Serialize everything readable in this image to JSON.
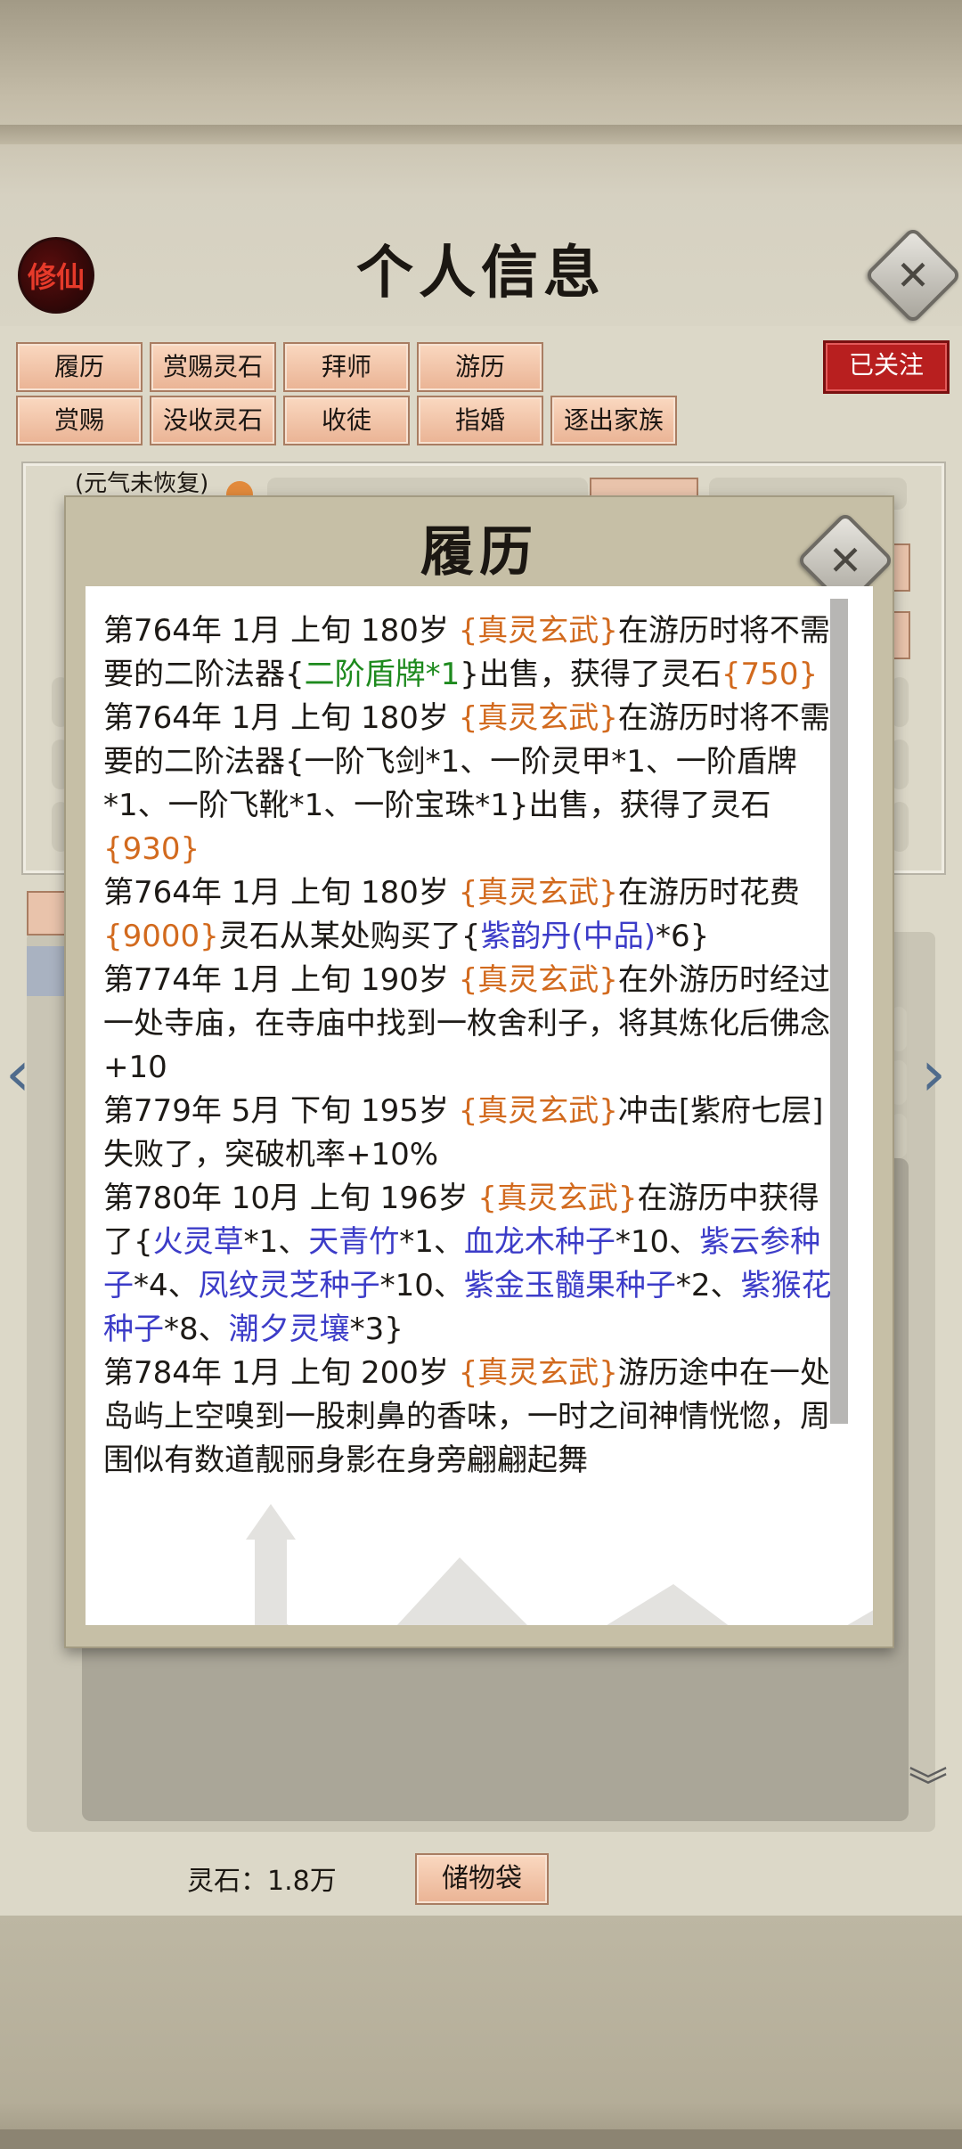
{
  "header": {
    "seal_text": "修仙",
    "title": "个人信息",
    "close_icon": "close-icon"
  },
  "buttons": {
    "row1": [
      "履历",
      "赏赐灵石",
      "拜师",
      "游历"
    ],
    "row2": [
      "赏赐",
      "没收灵石",
      "收徒",
      "指婚",
      "逐出家族"
    ],
    "follow": "已关注"
  },
  "profile": {
    "status_note": "(元气未恢复)"
  },
  "bottom": {
    "spirit_stones": "灵石：1.8万",
    "storage_bag": "储物袋"
  },
  "modal": {
    "title": "履历",
    "records": [
      [
        {
          "t": "第764年 1月 上旬 180岁 "
        },
        {
          "t": "{真灵玄武}",
          "c": "o"
        },
        {
          "t": "在游历时将不需要的二阶法器{"
        },
        {
          "t": "二阶盾牌*1",
          "c": "g"
        },
        {
          "t": "}出售，获得了灵石"
        },
        {
          "t": "{750}",
          "c": "o"
        }
      ],
      [
        {
          "t": "第764年 1月 上旬 180岁 "
        },
        {
          "t": "{真灵玄武}",
          "c": "o"
        },
        {
          "t": "在游历时将不需要的二阶法器{一阶飞剑*1、一阶灵甲*1、一阶盾牌*1、一阶飞靴*1、一阶宝珠*1}出售，获得了灵石"
        },
        {
          "t": "{930}",
          "c": "o"
        }
      ],
      [
        {
          "t": "第764年 1月 上旬  180岁  "
        },
        {
          "t": "{真灵玄武}",
          "c": "o"
        },
        {
          "t": "在游历时花费"
        },
        {
          "t": "{9000}",
          "c": "o"
        },
        {
          "t": "灵石从某处购买了{"
        },
        {
          "t": "紫韵丹(中品)",
          "c": "b"
        },
        {
          "t": "*6}"
        }
      ],
      [
        {
          "t": "第774年 1月 上旬 190岁 "
        },
        {
          "t": "{真灵玄武}",
          "c": "o"
        },
        {
          "t": "在外游历时经过一处寺庙，在寺庙中找到一枚舍利子，将其炼化后佛念+10"
        }
      ],
      [
        {
          "t": "第779年 5月 下旬  195岁 "
        },
        {
          "t": "{真灵玄武}",
          "c": "o"
        },
        {
          "t": "冲击[紫府七层]失败了，突破机率+10%"
        }
      ],
      [
        {
          "t": "第780年 10月 上旬  196岁 "
        },
        {
          "t": "{真灵玄武}",
          "c": "o"
        },
        {
          "t": "在游历中获得了{"
        },
        {
          "t": "火灵草",
          "c": "b"
        },
        {
          "t": "*1、"
        },
        {
          "t": "天青竹",
          "c": "b"
        },
        {
          "t": "*1、"
        },
        {
          "t": "血龙木种子",
          "c": "b"
        },
        {
          "t": "*10、"
        },
        {
          "t": "紫云参种子",
          "c": "b"
        },
        {
          "t": "*4、"
        },
        {
          "t": "凤纹灵芝种子",
          "c": "b"
        },
        {
          "t": "*10、"
        },
        {
          "t": "紫金玉髓果种子",
          "c": "b"
        },
        {
          "t": "*2、"
        },
        {
          "t": "紫猴花种子",
          "c": "b"
        },
        {
          "t": "*8、"
        },
        {
          "t": "潮夕灵壤",
          "c": "b"
        },
        {
          "t": "*3}"
        }
      ],
      [
        {
          "t": "第784年 1月 上旬 200岁 "
        },
        {
          "t": "{真灵玄武}",
          "c": "o"
        },
        {
          "t": "游历途中在一处岛屿上空嗅到一股刺鼻的香味，一时之间神情恍惚，周围似有数道靓丽身影在身旁翩翩起舞"
        }
      ]
    ]
  },
  "colors": {
    "highlight_orange": "#d26a1e",
    "item_green": "#1e8a1e",
    "item_blue": "#3c3cc8",
    "follow_red": "#b81f1f"
  },
  "icons": {
    "left_arrow": "chevron-left-icon",
    "right_arrow": "chevron-right-icon",
    "scroll_down": "chevron-down-icon"
  }
}
